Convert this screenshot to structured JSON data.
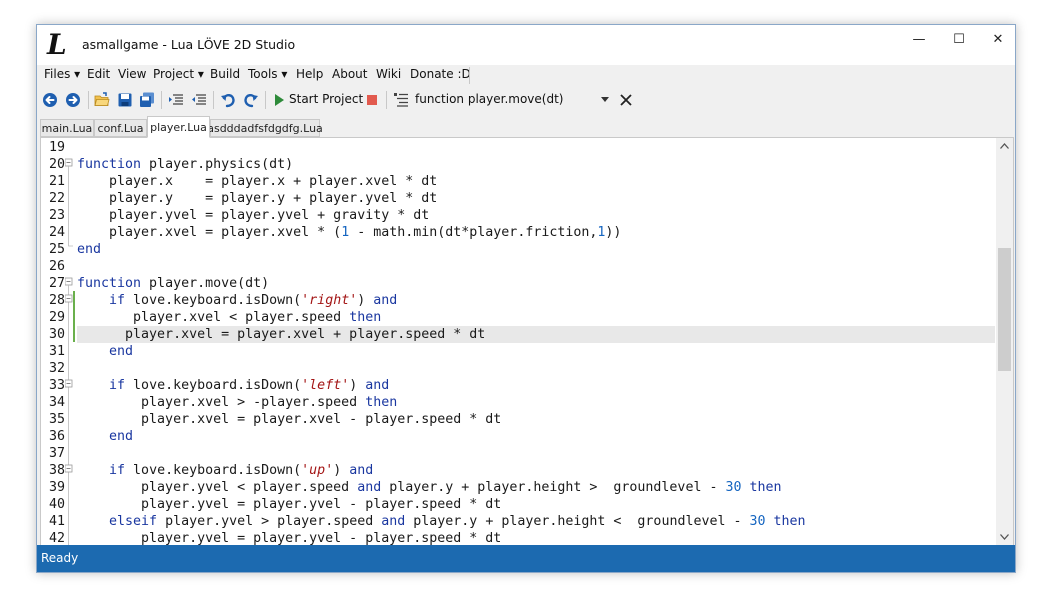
{
  "window": {
    "title": "asmallgame - Lua LÖVE 2D Studio",
    "logo": "L"
  },
  "window_controls": {
    "minimize": "—",
    "maximize": "☐",
    "close": "✕"
  },
  "menu": [
    "Files ▾",
    "Edit",
    "View",
    "Project ▾",
    "Build",
    "Tools ▾",
    "Help",
    "About",
    "Wiki",
    "Donate :D"
  ],
  "toolbar": {
    "start_label": "Start Project",
    "function_combo": "function player.move(dt)",
    "icons": [
      "back-arrow-icon",
      "forward-arrow-icon",
      "open-folder-icon",
      "save-icon",
      "save-all-icon",
      "indent-icon",
      "outdent-icon",
      "undo-icon",
      "redo-icon",
      "play-icon",
      "stop-icon",
      "function-list-icon",
      "close-icon"
    ]
  },
  "tabs": [
    "main.Lua",
    "conf.Lua",
    "player.Lua",
    "asdddadfsfdgdfg.Lua"
  ],
  "active_tab": 2,
  "editor": {
    "lines": [
      {
        "n": "19",
        "text": ""
      },
      {
        "n": "20",
        "text": "function player.physics(dt)"
      },
      {
        "n": "21",
        "text": "    player.x    = player.x + player.xvel * dt"
      },
      {
        "n": "22",
        "text": "    player.y    = player.y + player.yvel * dt"
      },
      {
        "n": "23",
        "text": "    player.yvel = player.yvel + gravity * dt"
      },
      {
        "n": "24",
        "text": "    player.xvel = player.xvel * (1 - math.min(dt*player.friction,1))"
      },
      {
        "n": "25",
        "text": "end"
      },
      {
        "n": "26",
        "text": ""
      },
      {
        "n": "27",
        "text": "function player.move(dt)"
      },
      {
        "n": "28",
        "text": "    if love.keyboard.isDown('right') and"
      },
      {
        "n": "29",
        "text": "       player.xvel < player.speed then"
      },
      {
        "n": "30",
        "text": "      player.xvel = player.xvel + player.speed * dt"
      },
      {
        "n": "31",
        "text": "    end"
      },
      {
        "n": "32",
        "text": ""
      },
      {
        "n": "33",
        "text": "    if love.keyboard.isDown('left') and"
      },
      {
        "n": "34",
        "text": "        player.xvel > -player.speed then"
      },
      {
        "n": "35",
        "text": "        player.xvel = player.xvel - player.speed * dt"
      },
      {
        "n": "36",
        "text": "    end"
      },
      {
        "n": "37",
        "text": ""
      },
      {
        "n": "38",
        "text": "    if love.keyboard.isDown('up') and"
      },
      {
        "n": "39",
        "text": "        player.yvel < player.speed and player.y + player.height >  groundlevel - 30 then"
      },
      {
        "n": "40",
        "text": "        player.yvel = player.yvel - player.speed * dt"
      },
      {
        "n": "41",
        "text": "    elseif player.yvel > player.speed and player.y + player.height <  groundlevel - 30 then"
      },
      {
        "n": "42",
        "text": "        player.yvel = player.yvel - player.speed * dt"
      }
    ],
    "fold_markers": [
      "20",
      "27",
      "28",
      "33",
      "38"
    ],
    "changed_lines": [
      "28",
      "29",
      "30"
    ],
    "current_line": "30"
  },
  "status": {
    "text": "Ready"
  },
  "colors": {
    "keyword": "#1a37a0",
    "string": "#a31515",
    "number": "#1565c0",
    "statusbar": "#1c6ab0"
  }
}
